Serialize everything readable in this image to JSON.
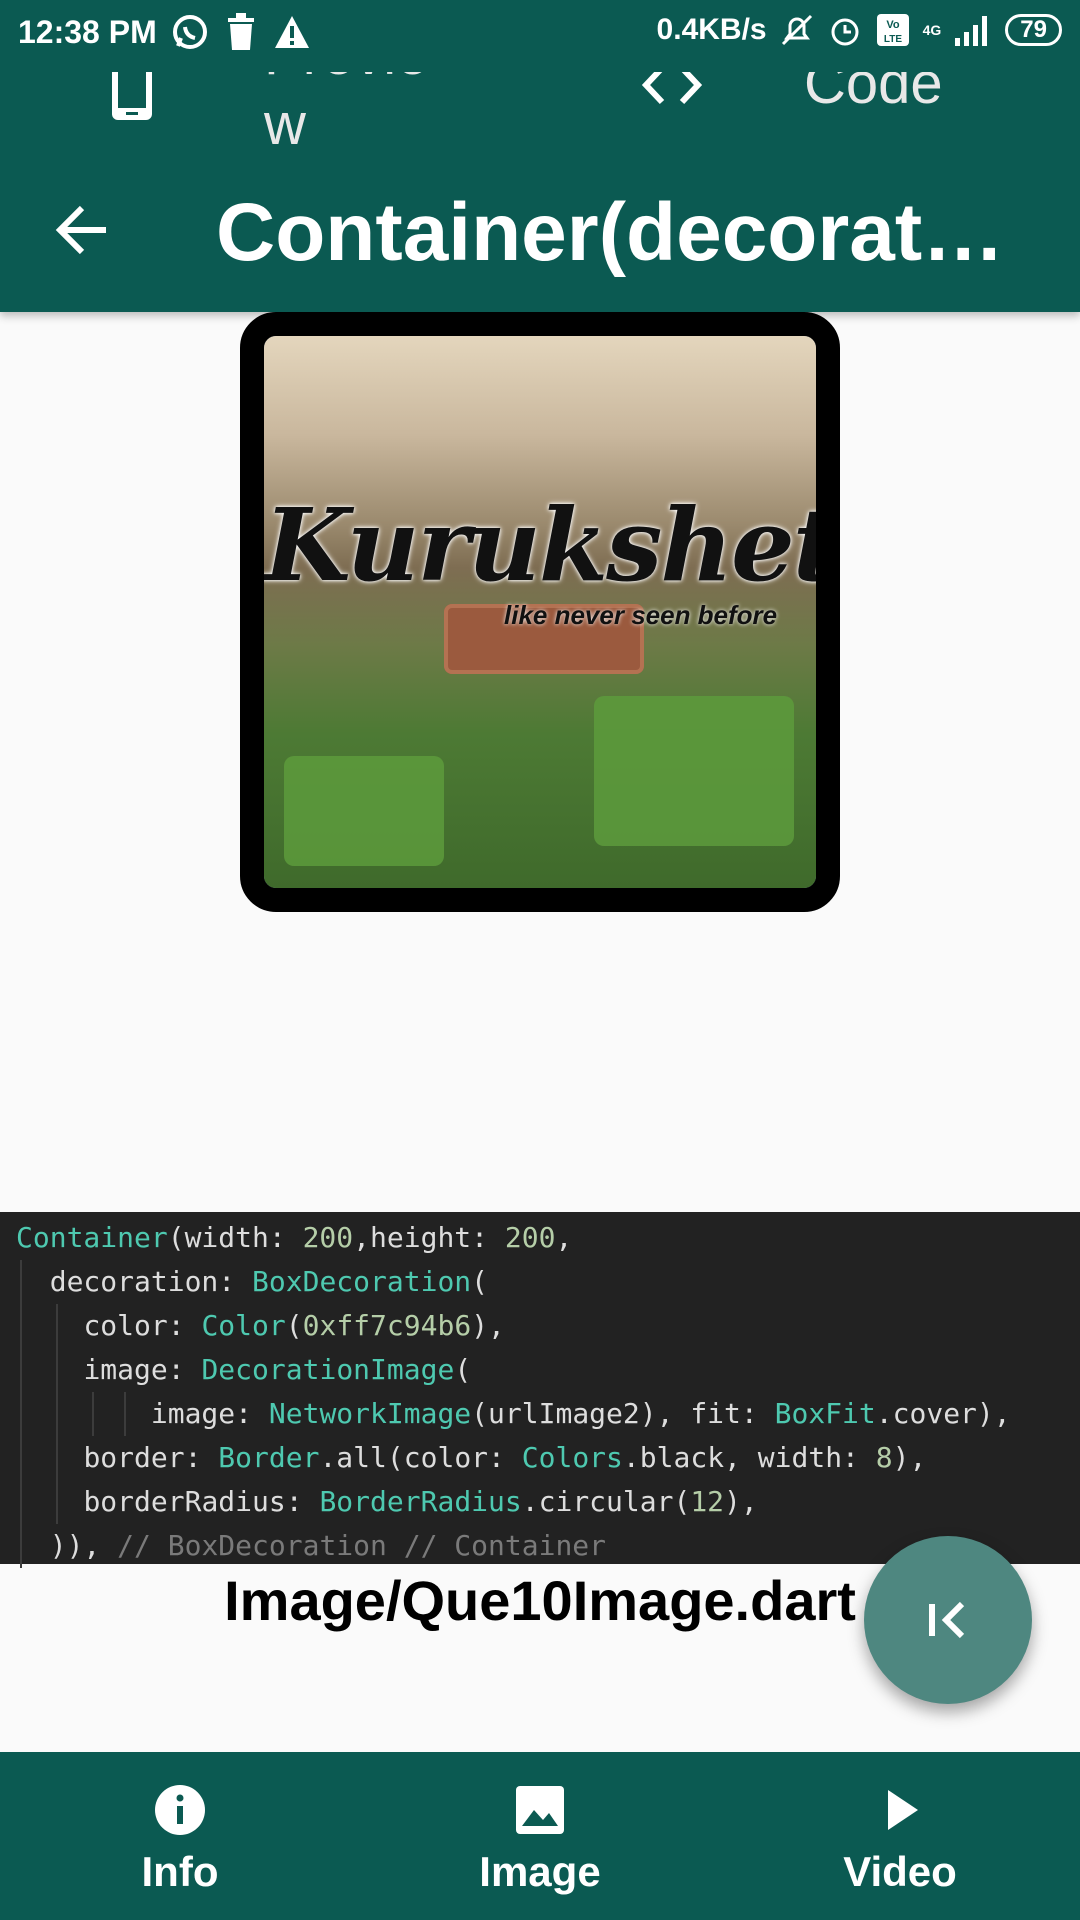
{
  "status_bar": {
    "time": "12:38 PM",
    "network_speed": "0.4KB/s",
    "network_type": "4G",
    "battery": "79"
  },
  "top_tabs": {
    "preview_label": "Preview",
    "code_label": "Code"
  },
  "app_bar": {
    "title": "Container(decoration..."
  },
  "preview": {
    "image_title": "Kurukshetra",
    "image_subtitle": "like never seen before"
  },
  "code": {
    "line1_class": "Container",
    "line1_rest": "(width: ",
    "line1_num1": "200",
    "line1_mid": ",height: ",
    "line1_num2": "200",
    "line1_end": ",",
    "line2_prop": "decoration: ",
    "line2_class": "BoxDecoration",
    "line2_end": "(",
    "line3_prop": "color: ",
    "line3_class": "Color",
    "line3_open": "(",
    "line3_num": "0xff7c94b6",
    "line3_end": "),",
    "line4_prop": "image: ",
    "line4_class": "DecorationImage",
    "line4_end": "(",
    "line5_prop": "image: ",
    "line5_class": "NetworkImage",
    "line5_mid": "(urlImage2), fit: ",
    "line5_class2": "BoxFit",
    "line5_end": ".cover),",
    "line6_prop": "border: ",
    "line6_class": "Border",
    "line6_mid": ".all(color: ",
    "line6_class2": "Colors",
    "line6_mid2": ".black, width: ",
    "line6_num": "8",
    "line6_end": "),",
    "line7_prop": "borderRadius: ",
    "line7_class": "BorderRadius",
    "line7_mid": ".circular(",
    "line7_num": "12",
    "line7_end": "),",
    "line8_code": ")),",
    "line8_comment": " // BoxDecoration // Container"
  },
  "filename": "Image/Que10Image.dart",
  "bottom_nav": {
    "info_label": "Info",
    "image_label": "Image",
    "video_label": "Video"
  },
  "colors": {
    "primary": "#0b5a52",
    "fab": "#4e8780",
    "code_bg": "#222222",
    "container_color": "#7c94b6"
  }
}
